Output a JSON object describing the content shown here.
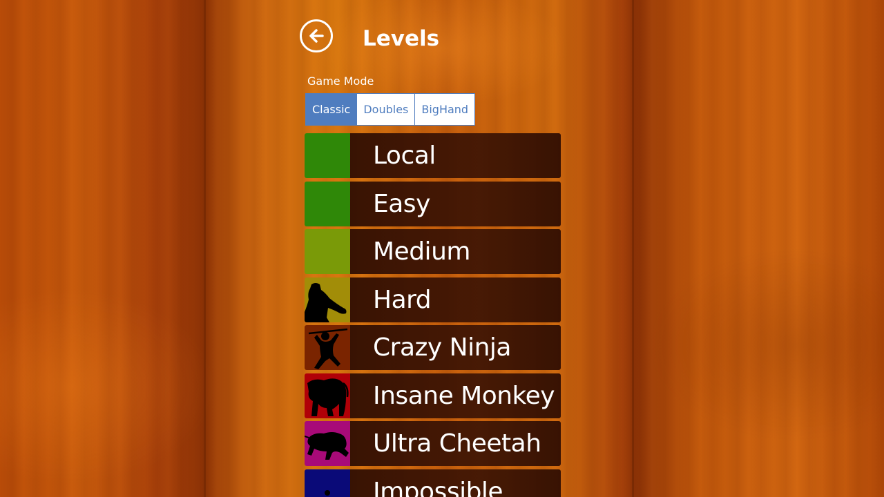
{
  "header": {
    "title": "Levels",
    "back_icon": "back-arrow-icon"
  },
  "game_mode": {
    "label": "Game Mode",
    "tabs": [
      {
        "label": "Classic",
        "selected": true
      },
      {
        "label": "Doubles",
        "selected": false
      },
      {
        "label": "BigHand",
        "selected": false
      }
    ]
  },
  "levels": [
    {
      "name": "Local",
      "color": "#2f8808",
      "icon": "none"
    },
    {
      "name": "Easy",
      "color": "#2f8808",
      "icon": "none"
    },
    {
      "name": "Medium",
      "color": "#7a9a08",
      "icon": "none"
    },
    {
      "name": "Hard",
      "color": "#a28d08",
      "icon": "fighter-silhouette-icon"
    },
    {
      "name": "Crazy Ninja",
      "color": "#7a2400",
      "icon": "ninja-silhouette-icon"
    },
    {
      "name": "Insane Monkey",
      "color": "#b00008",
      "icon": "monkey-silhouette-icon"
    },
    {
      "name": "Ultra Cheetah",
      "color": "#a80a78",
      "icon": "cheetah-silhouette-icon"
    },
    {
      "name": "Impossible",
      "color": "#0a0a78",
      "icon": "dot-icon"
    }
  ],
  "colors": {
    "accent": "#4f7dbf",
    "text": "#ffffff",
    "row_background": "#2d0c02"
  }
}
